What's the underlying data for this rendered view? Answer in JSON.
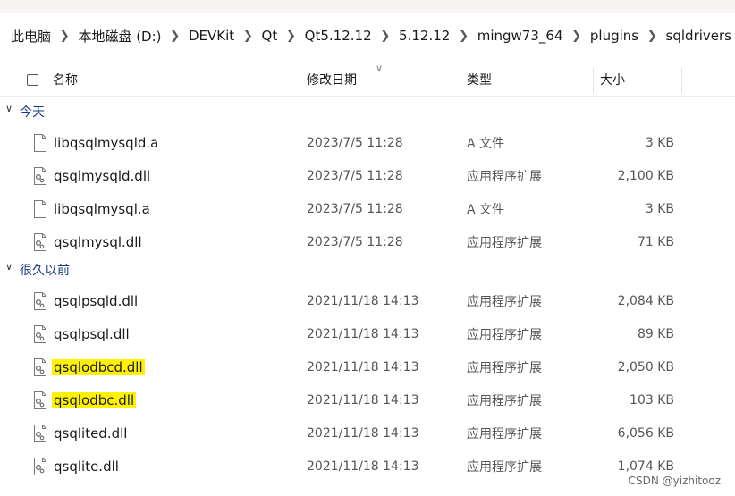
{
  "breadcrumb": [
    "此电脑",
    "本地磁盘 (D:)",
    "DEVKit",
    "Qt",
    "Qt5.12.12",
    "5.12.12",
    "mingw73_64",
    "plugins",
    "sqldrivers"
  ],
  "columns": {
    "name": "名称",
    "date": "修改日期",
    "type": "类型",
    "size": "大小"
  },
  "groups": [
    {
      "label": "今天",
      "files": [
        {
          "name": "libqsqlmysqld.a",
          "date": "2023/7/5 11:28",
          "type": "A 文件",
          "size": "3 KB",
          "icon": "generic-file-icon",
          "highlighted": false
        },
        {
          "name": "qsqlmysqld.dll",
          "date": "2023/7/5 11:28",
          "type": "应用程序扩展",
          "size": "2,100 KB",
          "icon": "dll-file-icon",
          "highlighted": false
        },
        {
          "name": "libqsqlmysql.a",
          "date": "2023/7/5 11:28",
          "type": "A 文件",
          "size": "3 KB",
          "icon": "generic-file-icon",
          "highlighted": false
        },
        {
          "name": "qsqlmysql.dll",
          "date": "2023/7/5 11:28",
          "type": "应用程序扩展",
          "size": "71 KB",
          "icon": "dll-file-icon",
          "highlighted": false
        }
      ]
    },
    {
      "label": "很久以前",
      "files": [
        {
          "name": "qsqlpsqld.dll",
          "date": "2021/11/18 14:13",
          "type": "应用程序扩展",
          "size": "2,084 KB",
          "icon": "dll-file-icon",
          "highlighted": false
        },
        {
          "name": "qsqlpsql.dll",
          "date": "2021/11/18 14:13",
          "type": "应用程序扩展",
          "size": "89 KB",
          "icon": "dll-file-icon",
          "highlighted": false
        },
        {
          "name": "qsqlodbcd.dll",
          "date": "2021/11/18 14:13",
          "type": "应用程序扩展",
          "size": "2,050 KB",
          "icon": "dll-file-icon",
          "highlighted": true
        },
        {
          "name": "qsqlodbc.dll",
          "date": "2021/11/18 14:13",
          "type": "应用程序扩展",
          "size": "103 KB",
          "icon": "dll-file-icon",
          "highlighted": true
        },
        {
          "name": "qsqlited.dll",
          "date": "2021/11/18 14:13",
          "type": "应用程序扩展",
          "size": "6,056 KB",
          "icon": "dll-file-icon",
          "highlighted": false
        },
        {
          "name": "qsqlite.dll",
          "date": "2021/11/18 14:13",
          "type": "应用程序扩展",
          "size": "1,074 KB",
          "icon": "dll-file-icon",
          "highlighted": false
        }
      ]
    }
  ],
  "watermark": "CSDN @yizhitooz",
  "colors": {
    "highlight": "#fff200",
    "group_label": "#1e3a8a"
  }
}
